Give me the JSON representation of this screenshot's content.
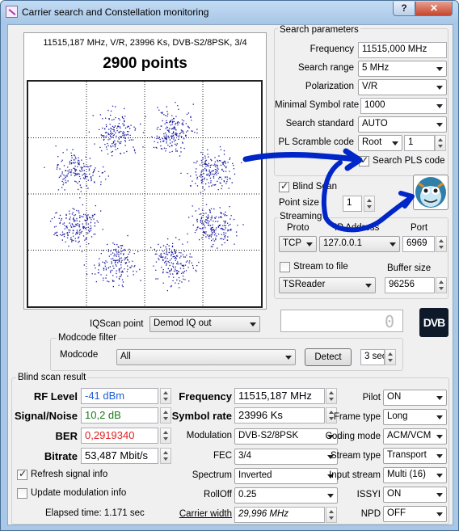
{
  "window": {
    "title": "Carrier search and Constellation monitoring",
    "help": "?",
    "close": "✕"
  },
  "plot": {
    "info": "11515,187 MHz, V/R, 23996 Ks, DVB-S2/8PSK, 3/4",
    "points": "2900 points"
  },
  "search": {
    "group_title": "Search parameters",
    "frequency_label": "Frequency",
    "frequency": "11515,000 MHz",
    "range_label": "Search range",
    "range": "5 MHz",
    "polarization_label": "Polarization",
    "polarization": "V/R",
    "msr_label": "Minimal Symbol rate",
    "msr": "1000",
    "standard_label": "Search standard",
    "standard": "AUTO",
    "pls_label": "PL Scramble code",
    "pls_mode": "Root",
    "pls_value": "1",
    "search_pls_label": "Search PLS code",
    "search_pls_checked": true
  },
  "blind": {
    "label": "Blind Scan",
    "checked": true,
    "point_size_label": "Point size",
    "point_size": "1"
  },
  "streaming": {
    "group_title": "Streaming",
    "proto_label": "Proto",
    "address_label": "IP Address",
    "port_label": "Port",
    "proto": "TCP",
    "address": "127.0.0.1",
    "port": "6969",
    "stream_to_file_label": "Stream to file",
    "stream_to_file_checked": false,
    "buffer_label": "Buffer size",
    "reader": "TSReader",
    "buffer": "96256"
  },
  "iqscan": {
    "label": "IQScan point",
    "value": "Demod IQ out",
    "lcd": "0"
  },
  "modcode": {
    "group_title": "Modcode filter",
    "label": "Modcode",
    "value": "All",
    "detect": "Detect",
    "interval": "3 sec"
  },
  "logo": "DVB",
  "result": {
    "group_title": "Blind scan result",
    "rf_label": "RF Level",
    "rf": "-41 dBm",
    "sn_label": "Signal/Noise",
    "sn": "10,2 dB",
    "ber_label": "BER",
    "ber": "0,2919340",
    "bitrate_label": "Bitrate",
    "bitrate": "53,487 Mbit/s",
    "freq_label": "Frequency",
    "freq": "11515,187 MHz",
    "sr_label": "Symbol rate",
    "sr": "23996 Ks",
    "mod_label": "Modulation",
    "mod": "DVB-S2/8PSK",
    "fec_label": "FEC",
    "fec": "3/4",
    "spectrum_label": "Spectrum",
    "spectrum": "Inverted",
    "rolloff_label": "RollOff",
    "rolloff": "0.25",
    "cw_label": "Carrier width",
    "cw": "29,996 MHz",
    "pilot_label": "Pilot",
    "pilot": "ON",
    "frame_label": "Frame type",
    "frame": "Long",
    "coding_label": "Coding mode",
    "coding": "ACM/VCM",
    "stype_label": "Stream type",
    "stype": "Transport",
    "istream_label": "Input stream",
    "istream": "Multi (16)",
    "issyi_label": "ISSYI",
    "issyi": "ON",
    "npd_label": "NPD",
    "npd": "OFF",
    "refresh_label": "Refresh signal info",
    "refresh_checked": true,
    "update_label": "Update modulation info",
    "update_checked": false,
    "elapsed": "Elapsed time: 1.171 sec"
  },
  "colors": {
    "rf": "#1c5fd6",
    "sn": "#1a7a1a",
    "ber": "#e02020",
    "annotation": "#0026c8",
    "dots": "#1a1aa0"
  }
}
